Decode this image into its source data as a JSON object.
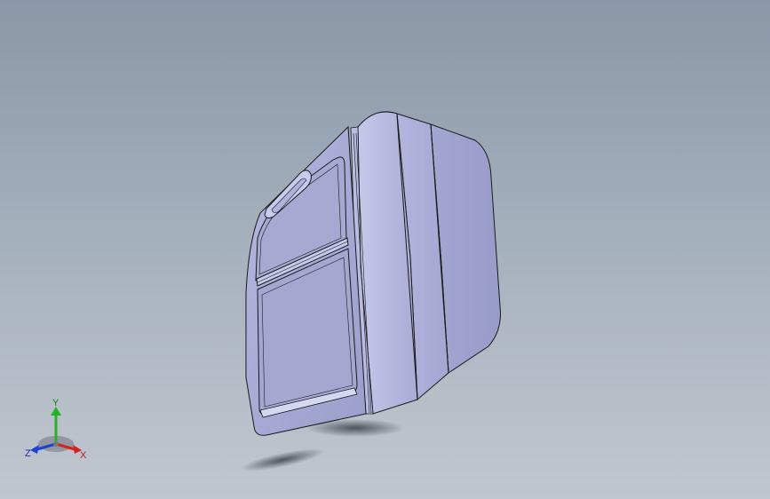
{
  "triad": {
    "x_label": "X",
    "y_label": "Y",
    "z_label": "Z",
    "colors": {
      "x": "#d62020",
      "y": "#22b422",
      "z": "#2040d0"
    }
  },
  "viewport": {
    "background_top": "#8997a8",
    "background_bottom": "#c1c7cf",
    "model_color": "#a8aad4",
    "edge_color": "#1a1a1a"
  }
}
